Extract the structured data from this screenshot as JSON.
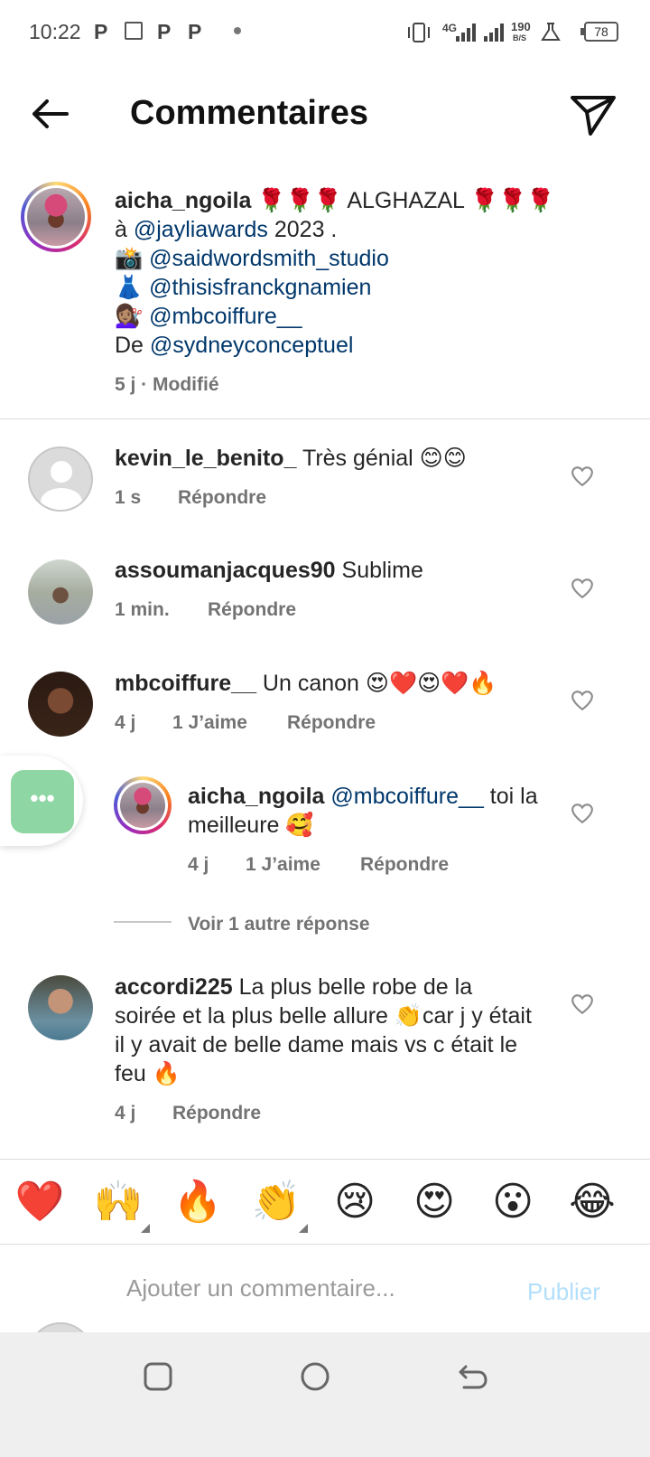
{
  "status": {
    "time": "10:22",
    "notif_icons": [
      "P",
      "P",
      "P"
    ],
    "network": "4G",
    "speed_value": "190",
    "speed_unit": "B/S",
    "battery": "78"
  },
  "header": {
    "title": "Commentaires"
  },
  "caption": {
    "username": "aicha_ngoila",
    "line1": " 🌹🌹🌹 ALGHAZAL 🌹🌹🌹",
    "line2_pre": "à ",
    "line2_mention": "@jayliawards",
    "line2_post": " 2023 .",
    "line3_emoji": "📸 ",
    "line3_mention": "@saidwordsmith_studio",
    "line4_emoji": "👗 ",
    "line4_mention": "@thisisfranckgnamien",
    "line5_emoji": "💇🏽‍♀️ ",
    "line5_mention": "@mbcoiffure__",
    "line6_pre": "De ",
    "line6_mention": "@sydneyconceptuel",
    "meta": "5 j · Modifié"
  },
  "comments": [
    {
      "username": "kevin_le_benito_",
      "text": " Très génial 😊😊",
      "time": "1 s",
      "reply": "Répondre"
    },
    {
      "username": "assoumanjacques90",
      "text": " Sublime",
      "time": "1 min.",
      "reply": "Répondre"
    },
    {
      "username": "mbcoiffure__",
      "text": " Un canon 😍❤️😍❤️🔥",
      "time": "4 j",
      "likes": "1 J’aime",
      "reply": "Répondre"
    },
    {
      "username": "accordi225",
      "text": " La plus belle robe de la soirée et la plus belle allure 👏car j y était il y avait de belle dame mais vs c était le feu 🔥",
      "time": "4 j",
      "reply": "Répondre"
    }
  ],
  "reply": {
    "username": "aicha_ngoila",
    "mention": " @mbcoiffure__",
    "text": " toi la meilleure 🥰",
    "time": "4 j",
    "likes": "1 J’aime",
    "reply": "Répondre"
  },
  "view_more": "Voir 1 autre réponse",
  "bubble_icon": "•••",
  "emojis": [
    "❤️",
    "🙌",
    "🔥",
    "👏",
    "😢",
    "😍",
    "😮",
    "😂"
  ],
  "input": {
    "placeholder": "Ajouter un commentaire...",
    "publish": "Publier"
  }
}
